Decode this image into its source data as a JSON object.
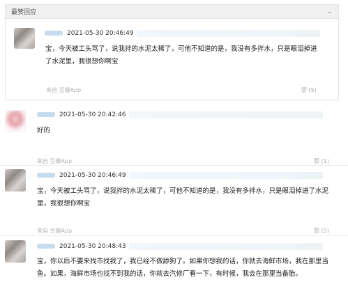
{
  "section": {
    "title": "最赞回应",
    "toggle_icon": "chevron-down-icon"
  },
  "comments": [
    {
      "time": "2021-05-30 20:46:49",
      "text": "宝，今天被工头骂了，说我拌的水泥太稀了，可他不知道的是，我没有多拌水，只是眼泪掉进了水泥里，我很想你啊宝",
      "source": "来自 豆瓣App",
      "like": "赞 (5)"
    },
    {
      "time": "2021-05-30 20:42:46",
      "text": "好的",
      "source": "来自 豆瓣App",
      "like": "赞 (1)"
    },
    {
      "time": "2021-05-30 20:46:49",
      "text": "宝，今天被工头骂了，说我拌的水泥太稀了，可他不知道的是，我没有多拌水，只是眼泪掉进了水泥里，我很想你啊宝",
      "source": "来自 豆瓣App",
      "like": "赞 (5)"
    },
    {
      "time": "2021-05-30 20:48:43",
      "text": "宝，你以后不要来找市找我了，我已经不做舔狗了。如果你想我的话，你就去海鲜市场，我在那里当鱼。如果，海鲜市场也找不到我的话，你就去汽修厂看一下，有时候，我会在那里当备胎。"
    }
  ]
}
